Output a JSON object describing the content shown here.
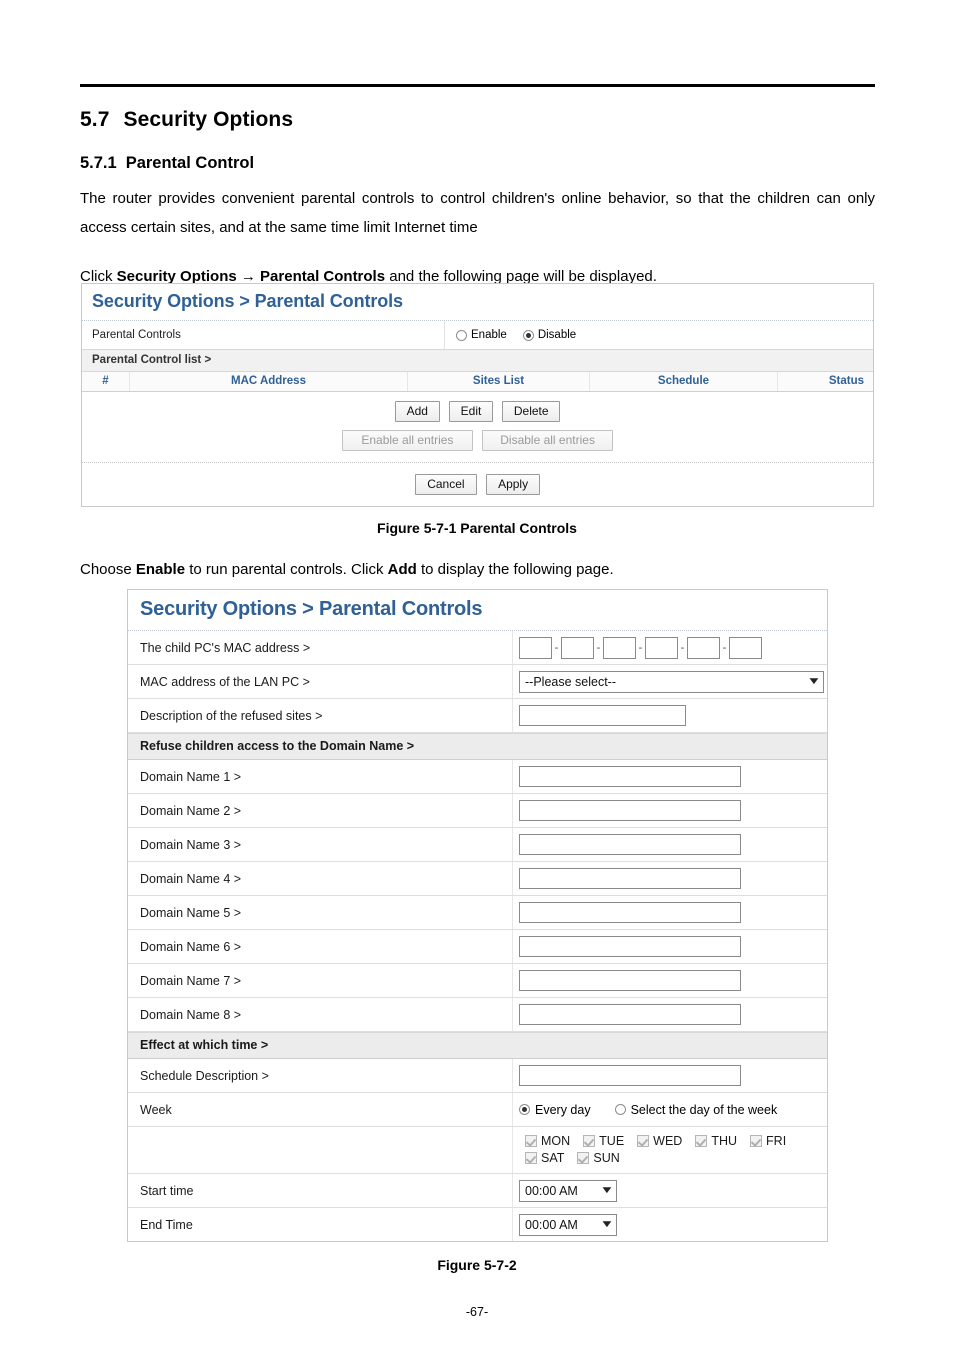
{
  "document": {
    "section_number": "5.7",
    "section_title": "Security Options",
    "subsection_number": "5.7.1",
    "subsection_title": "Parental Control",
    "intro_paragraph": "The router provides convenient parental controls to control children's online behavior, so that the children can only access certain sites, and at the same time limit Internet time",
    "click_line_prefix": "Click ",
    "click_line_bold1": "Security Options",
    "click_line_arrow": "→",
    "click_line_bold2": "Parental Controls",
    "click_line_suffix": " and the following page will be displayed.",
    "choose_line_prefix": "Choose ",
    "choose_line_bold1": "Enable",
    "choose_line_mid": " to run parental controls. Click ",
    "choose_line_bold2": "Add",
    "choose_line_suffix": " to display the following page.",
    "figure1_caption": "Figure 5-7-1 Parental Controls",
    "figure2_caption": "Figure 5-7-2",
    "page_number": "-67-"
  },
  "colors": {
    "ui_header_blue": "#2f6096",
    "table_header_blue": "#2f6096",
    "section_band": "#ececec",
    "disabled_text": "#9a9a9a"
  },
  "figure1": {
    "header_title": "Security Options > Parental Controls",
    "parental_controls_label": "Parental Controls",
    "radio_enable_label": "Enable",
    "radio_disable_label": "Disable",
    "radio_selected": "Disable",
    "list_section_label": "Parental Control list >",
    "table_headers": [
      "#",
      "MAC Address",
      "Sites List",
      "Schedule",
      "Status"
    ],
    "table_rows": [],
    "buttons_row1": [
      {
        "label": "Add",
        "disabled": false
      },
      {
        "label": "Edit",
        "disabled": false
      },
      {
        "label": "Delete",
        "disabled": false
      }
    ],
    "buttons_row2": [
      {
        "label": "Enable all entries",
        "disabled": true
      },
      {
        "label": "Disable all entries",
        "disabled": true
      }
    ],
    "buttons_footer": [
      {
        "label": "Cancel",
        "disabled": false
      },
      {
        "label": "Apply",
        "disabled": false
      }
    ]
  },
  "figure2": {
    "header_title": "Security Options > Parental Controls",
    "rows": {
      "child_mac_label": "The child PC's MAC address >",
      "mac_octets": [
        "",
        "",
        "",
        "",
        "",
        ""
      ],
      "mac_separator": "-",
      "lan_pc_label": "MAC address of the LAN PC >",
      "lan_pc_value": "--Please select--",
      "description_label": "Description of the refused sites >",
      "description_value": ""
    },
    "domain_section_label": "Refuse children access to the Domain Name >",
    "domain_rows": [
      {
        "label": "Domain Name 1 >",
        "value": ""
      },
      {
        "label": "Domain Name 2 >",
        "value": ""
      },
      {
        "label": "Domain Name 3 >",
        "value": ""
      },
      {
        "label": "Domain Name 4 >",
        "value": ""
      },
      {
        "label": "Domain Name 5 >",
        "value": ""
      },
      {
        "label": "Domain Name 6 >",
        "value": ""
      },
      {
        "label": "Domain Name 7 >",
        "value": ""
      },
      {
        "label": "Domain Name 8 >",
        "value": ""
      }
    ],
    "time_section_label": "Effect at which time >",
    "schedule_description_label": "Schedule Description >",
    "schedule_description_value": "",
    "week_label": "Week",
    "week_radio_everyday": "Every day",
    "week_radio_select": "Select the day of the week",
    "week_radio_selected": "Every day",
    "days": [
      {
        "label": "MON",
        "checked": true,
        "disabled": true
      },
      {
        "label": "TUE",
        "checked": true,
        "disabled": true
      },
      {
        "label": "WED",
        "checked": true,
        "disabled": true
      },
      {
        "label": "THU",
        "checked": true,
        "disabled": true
      },
      {
        "label": "FRI",
        "checked": true,
        "disabled": true
      },
      {
        "label": "SAT",
        "checked": true,
        "disabled": true
      },
      {
        "label": "SUN",
        "checked": true,
        "disabled": true
      }
    ],
    "start_time_label": "Start time",
    "start_time_value": "00:00 AM",
    "end_time_label": "End Time",
    "end_time_value": "00:00 AM",
    "dropdown_icon": "chevron-down-icon"
  }
}
